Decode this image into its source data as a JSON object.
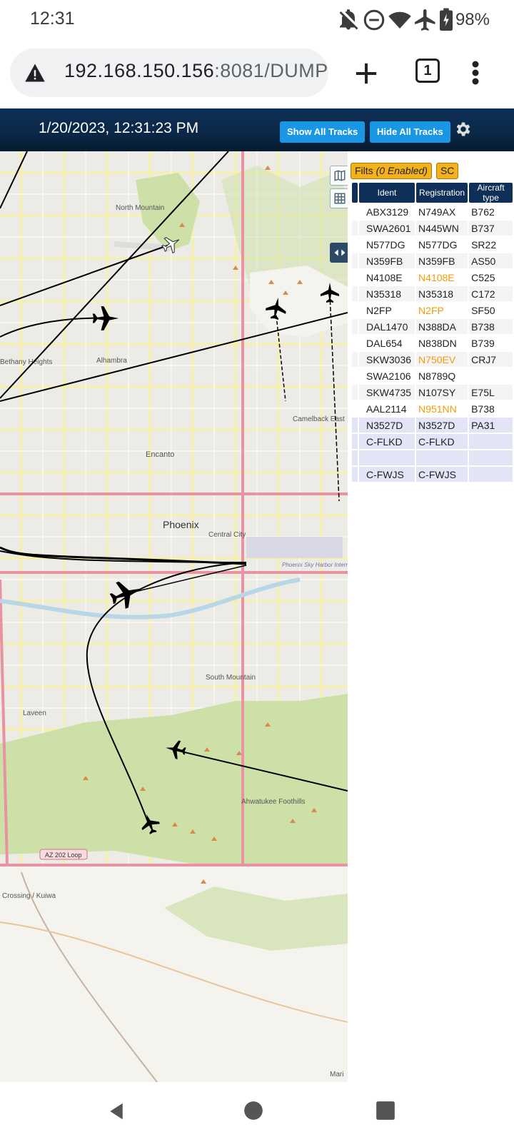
{
  "status_bar": {
    "time": "12:31",
    "battery": "98%",
    "icons": [
      "bell-off-icon",
      "do-not-disturb-icon",
      "wifi-icon",
      "airplane-mode-icon",
      "battery-charging-icon"
    ]
  },
  "browser": {
    "url_host": "192.168.150.156",
    "url_rest": ":8081/DUMP",
    "tab_count": "1"
  },
  "app": {
    "datetime": "1/20/2023, 12:31:23 PM",
    "show_all_tracks": "Show All Tracks",
    "hide_all_tracks": "Hide All Tracks",
    "accent_color": "#1a97e3",
    "header_color": "#0e2f57"
  },
  "map": {
    "labels": {
      "north_mountain": "North Mountain",
      "bethany_heights": "Bethany Heights",
      "alhambra": "Alhambra",
      "encanto": "Encanto",
      "phoenix": "Phoenix",
      "central_city": "Central City",
      "camelback_east": "Camelback East",
      "sky_harbor": "Phoenix Sky Harbor International Airport",
      "south_mountain": "South Mountain",
      "laveen": "Laveen",
      "ahwatukee": "Ahwatukee Foothills",
      "loop202": "AZ 202 Loop",
      "crossing": "Crossing / Kuiwa",
      "maricopa": "Mari"
    }
  },
  "panel": {
    "filters_label": "Filts ",
    "filters_state": "(0 Enabled)",
    "sc_label": "SC",
    "columns": [
      "Ident",
      "Registration",
      "Aircraft type"
    ],
    "rows": [
      {
        "ident": "ABX3129",
        "reg": "N749AX",
        "type": "B762",
        "reg_highlight": false
      },
      {
        "ident": "SWA2601",
        "reg": "N445WN",
        "type": "B737",
        "reg_highlight": false
      },
      {
        "ident": "N577DG",
        "reg": "N577DG",
        "type": "SR22",
        "reg_highlight": false
      },
      {
        "ident": "N359FB",
        "reg": "N359FB",
        "type": "AS50",
        "reg_highlight": false
      },
      {
        "ident": "N4108E",
        "reg": "N4108E",
        "type": "C525",
        "reg_highlight": true
      },
      {
        "ident": "N35318",
        "reg": "N35318",
        "type": "C172",
        "reg_highlight": false
      },
      {
        "ident": "N2FP",
        "reg": "N2FP",
        "type": "SF50",
        "reg_highlight": true
      },
      {
        "ident": "DAL1470",
        "reg": "N388DA",
        "type": "B738",
        "reg_highlight": false
      },
      {
        "ident": "DAL654",
        "reg": "N838DN",
        "type": "B739",
        "reg_highlight": false
      },
      {
        "ident": "SKW3036",
        "reg": "N750EV",
        "type": "CRJ7",
        "reg_highlight": true
      },
      {
        "ident": "SWA2106",
        "reg": "N8789Q",
        "type": "",
        "reg_highlight": false
      },
      {
        "ident": "SKW4735",
        "reg": "N107SY",
        "type": "E75L",
        "reg_highlight": false
      },
      {
        "ident": "AAL2114",
        "reg": "N951NN",
        "type": "B738",
        "reg_highlight": true
      },
      {
        "ident": "N3527D",
        "reg": "N3527D",
        "type": "PA31",
        "reg_highlight": false
      },
      {
        "ident": "C-FLKD",
        "reg": "C-FLKD",
        "type": "",
        "reg_highlight": false
      },
      {
        "ident": "",
        "reg": "",
        "type": "",
        "reg_highlight": false
      },
      {
        "ident": "C-FWJS",
        "reg": "C-FWJS",
        "type": "",
        "reg_highlight": false
      }
    ]
  },
  "nav": {
    "icons": [
      "back-icon",
      "home-icon",
      "recents-icon"
    ]
  }
}
